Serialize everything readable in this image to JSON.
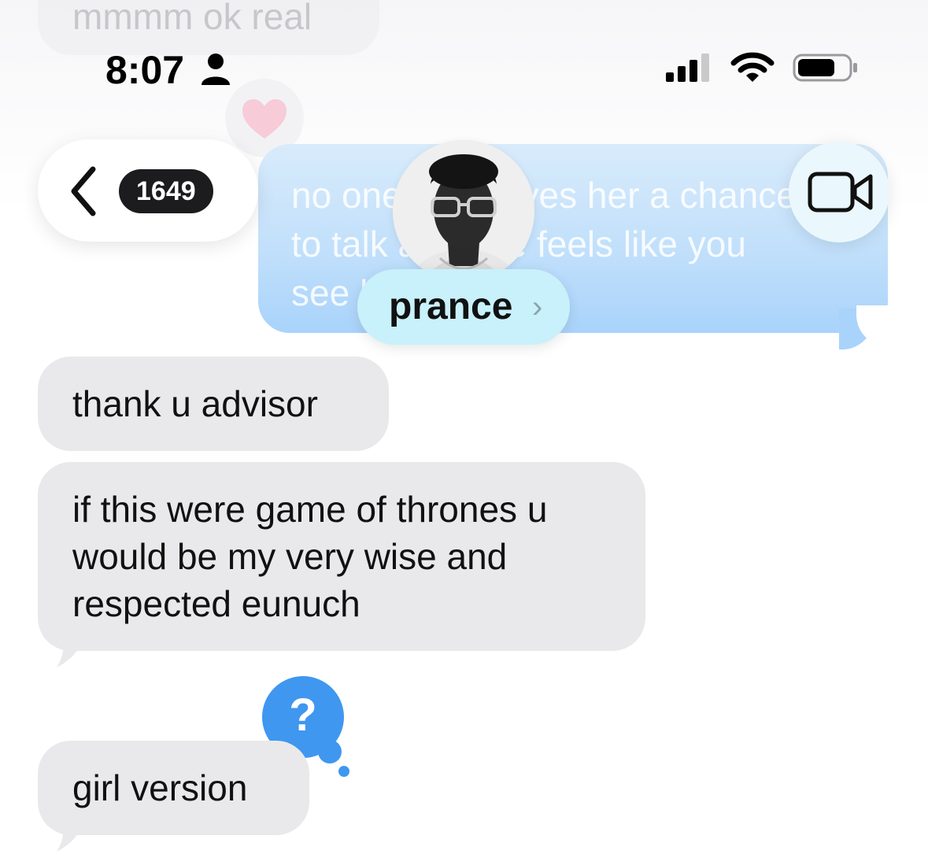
{
  "status_bar": {
    "time": "8:07"
  },
  "nav": {
    "unread_count": "1649"
  },
  "contact": {
    "name": "prance",
    "chevron": "›"
  },
  "messages": {
    "top_faded": "mmmm ok real",
    "sent_line1": "no one ever gives her a chance",
    "sent_line2": "to talk and she feels like you",
    "sent_line3": "see her",
    "m1": "thank u advisor",
    "m2_line1": "if this were game of thrones u",
    "m2_line2": "would be my very wise and",
    "m2_line3": "respected eunuch",
    "m3": "girl version"
  },
  "reactions": {
    "heart": "heart-icon",
    "question": "?"
  },
  "colors": {
    "received_bubble": "#e9e9eb",
    "sent_bubble": "#a9d3fb",
    "reaction_blue": "#3f97f0",
    "badge": "#1c1c1e",
    "name_pill": "#c8f1fb"
  }
}
